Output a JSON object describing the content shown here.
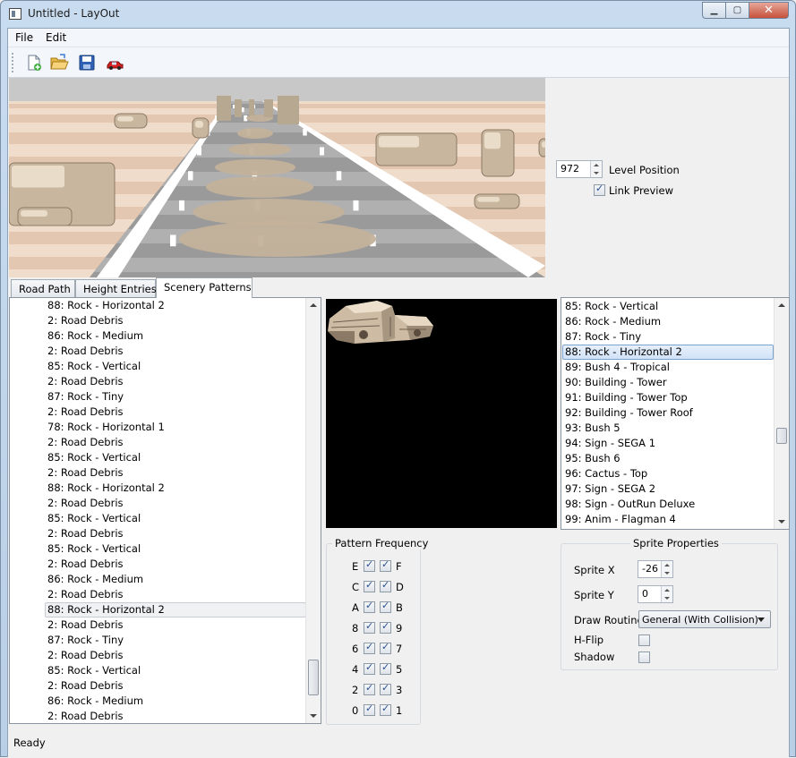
{
  "window": {
    "title": "Untitled - LayOut"
  },
  "menu": {
    "file": "File",
    "edit": "Edit"
  },
  "preview": {
    "level_position_value": "972",
    "level_position_label": "Level Position",
    "link_preview_label": "Link Preview",
    "link_preview_checked": true
  },
  "tabs": [
    {
      "label": "Road Path",
      "active": false
    },
    {
      "label": "Height Entries",
      "active": false
    },
    {
      "label": "Scenery Patterns",
      "active": true
    }
  ],
  "pattern_list": {
    "items": [
      "88: Rock - Horizontal 2",
      "2: Road Debris",
      "86: Rock - Medium",
      "2: Road Debris",
      "85: Rock - Vertical",
      "2: Road Debris",
      "87: Rock - Tiny",
      "2: Road Debris",
      "78: Rock - Horizontal 1",
      "2: Road Debris",
      "85: Rock - Vertical",
      "2: Road Debris",
      "88: Rock - Horizontal 2",
      "2: Road Debris",
      "85: Rock - Vertical",
      "2: Road Debris",
      "85: Rock - Vertical",
      "2: Road Debris",
      "86: Rock - Medium",
      "2: Road Debris",
      "88: Rock - Horizontal 2",
      "2: Road Debris",
      "87: Rock - Tiny",
      "2: Road Debris",
      "85: Rock - Vertical",
      "2: Road Debris",
      "86: Rock - Medium",
      "2: Road Debris"
    ],
    "selected_index": 20
  },
  "sprite_list": {
    "items": [
      "85: Rock - Vertical",
      "86: Rock - Medium",
      "87: Rock - Tiny",
      "88: Rock - Horizontal 2",
      "89: Bush 4 - Tropical",
      "90: Building - Tower",
      "91: Building - Tower Top",
      "92: Building - Tower Roof",
      "93: Bush 5",
      "94: Sign - SEGA 1",
      "95: Bush 6",
      "96: Cactus - Top",
      "97: Sign - SEGA 2",
      "98: Sign - OutRun Deluxe",
      "99: Anim - Flagman 4"
    ],
    "selected_index": 3
  },
  "pattern_frequency": {
    "title": "Pattern Frequency",
    "rows": [
      {
        "left": "E",
        "right": "F"
      },
      {
        "left": "C",
        "right": "D"
      },
      {
        "left": "A",
        "right": "B"
      },
      {
        "left": "8",
        "right": "9"
      },
      {
        "left": "6",
        "right": "7"
      },
      {
        "left": "4",
        "right": "5"
      },
      {
        "left": "2",
        "right": "3"
      },
      {
        "left": "0",
        "right": "1"
      }
    ]
  },
  "sprite_properties": {
    "title": "Sprite Properties",
    "sprite_x_label": "Sprite X",
    "sprite_x_value": "-26",
    "sprite_y_label": "Sprite Y",
    "sprite_y_value": "0",
    "draw_routine_label": "Draw Routine",
    "draw_routine_value": "General (With Collision)",
    "hflip_label": "H-Flip",
    "shadow_label": "Shadow"
  },
  "status": {
    "text": "Ready"
  },
  "colors": {
    "sky": "#c8c8c8",
    "sand_light": "#f0dccb",
    "sand_dark": "#e3c7b1",
    "road": "#9a9a9a",
    "road_light": "#b0b0b0"
  }
}
